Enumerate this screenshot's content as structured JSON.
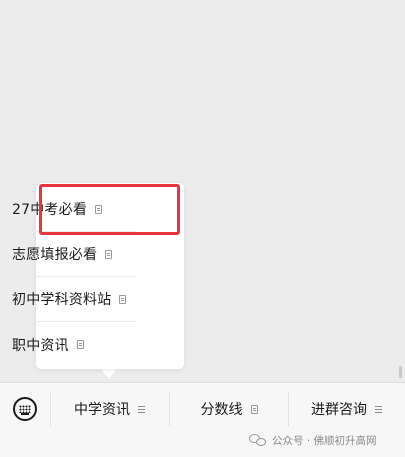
{
  "submenu": {
    "items": [
      {
        "label": "27中考必看",
        "icon": "page-icon",
        "highlighted": true
      },
      {
        "label": "志愿填报必看",
        "icon": "page-icon"
      },
      {
        "label": "初中学科资料站",
        "icon": "page-icon"
      },
      {
        "label": "职中资讯",
        "icon": "page-icon"
      }
    ],
    "highlight_color": "#e8343c"
  },
  "menu_bar": {
    "keyboard_icon": "keyboard-icon",
    "buttons": [
      {
        "label": "中学资讯",
        "icon": "menu-lines-icon"
      },
      {
        "label": "分数线",
        "icon": "page-icon"
      },
      {
        "label": "进群咨询",
        "icon": "menu-lines-icon"
      }
    ]
  },
  "watermark": {
    "text": "公众号 · 佛顺初升高网",
    "icon": "wechat-icon"
  }
}
